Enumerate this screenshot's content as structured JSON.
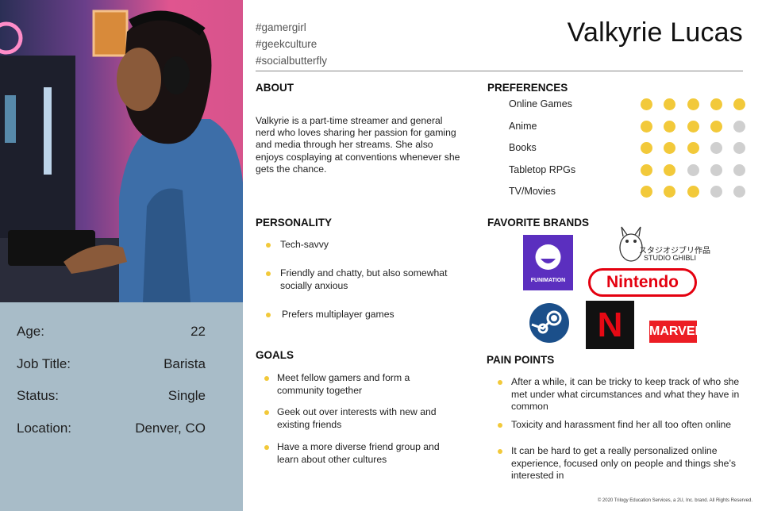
{
  "persona": {
    "name": "Valkyrie Lucas",
    "tags": [
      "#gamergirl",
      "#geekculture",
      "#socialbutterfly"
    ]
  },
  "stats": [
    {
      "label": "Age:",
      "value": "22"
    },
    {
      "label": "Job Title:",
      "value": "Barista"
    },
    {
      "label": "Status:",
      "value": "Single"
    },
    {
      "label": "Location:",
      "value": "Denver, CO"
    }
  ],
  "about": {
    "heading": "ABOUT",
    "text": "Valkyrie is a part-time streamer and general nerd who loves sharing her passion for gaming and media through her streams. She also enjoys cosplaying at conventions whenever she gets the chance."
  },
  "personality": {
    "heading": "PERSONALITY",
    "items": [
      "Tech-savvy",
      "Friendly and chatty, but also somewhat socially anxious",
      "Prefers multiplayer games"
    ]
  },
  "goals": {
    "heading": "GOALS",
    "items": [
      "Meet fellow gamers and form a community together",
      "Geek out over interests with new and existing friends",
      "Have a more diverse friend group and learn about other cultures"
    ]
  },
  "preferences": {
    "heading": "PREFERENCES",
    "max": 5,
    "filled_color": "#f2c93a",
    "empty_color": "#cfcfcf",
    "items": [
      {
        "label": "Online Games",
        "rating": 5
      },
      {
        "label": "Anime",
        "rating": 4
      },
      {
        "label": "Books",
        "rating": 3
      },
      {
        "label": "Tabletop RPGs",
        "rating": 2
      },
      {
        "label": "TV/Movies",
        "rating": 3
      }
    ]
  },
  "brands": {
    "heading": "FAVORITE BRANDS",
    "funimation": "FUNIMATION",
    "ghibli_jp": "スタジオジブリ作品",
    "ghibli_en": "STUDIO GHIBLI",
    "nintendo": "Nintendo",
    "netflix": "N",
    "marvel": "MARVEL"
  },
  "pain_points": {
    "heading": "PAIN POINTS",
    "items": [
      "After a while, it can be tricky to keep track of who she met under what circumstances and what they have in common",
      "Toxicity and harassment find her all too often online",
      "It can be hard to get a really personalized online experience, focused only on people and things she’s interested in"
    ]
  },
  "footer": "© 2020 Trilogy Education Services, a 2U, Inc. brand. All Rights Reserved."
}
